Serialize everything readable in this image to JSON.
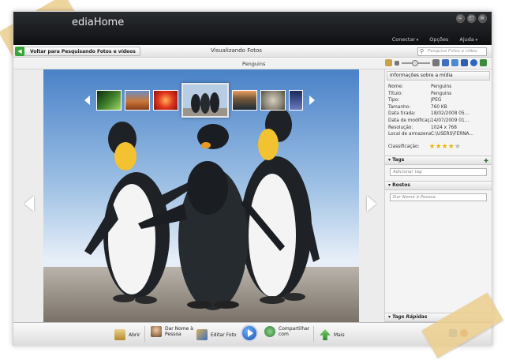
{
  "window": {
    "title": "MediaHome",
    "title_visible": "ediaHome",
    "menu": [
      "Conectar",
      "Opções",
      "Ajuda"
    ]
  },
  "nav": {
    "back_label": "Voltar para Pesquisando Fotos e vídeos",
    "view_title": "Visualizando Fotos",
    "search_placeholder": "Pesquisa Fotos e vídeo"
  },
  "photo": {
    "name": "Penguins",
    "zoom_fraction": 0.45
  },
  "filmstrip": {
    "thumbnails": [
      "flower-green",
      "desert",
      "chrysanthemum",
      "penguins",
      "lighthouse",
      "koala",
      "jellyfish"
    ],
    "selected_index": 3
  },
  "panel": {
    "header": "Informações sobre a mídia",
    "properties": [
      {
        "key": "Nome:",
        "value": "Penguins"
      },
      {
        "key": "Título:",
        "value": "Penguins"
      },
      {
        "key": "Tipo:",
        "value": "JPEG"
      },
      {
        "key": "Tamanho:",
        "value": "760 KB"
      },
      {
        "key": "Data tirada:",
        "value": "18/02/2008 05..."
      },
      {
        "key": "Data de modificação:",
        "value": "14/07/2009 01..."
      },
      {
        "key": "Resolução:",
        "value": "1024 x 768"
      },
      {
        "key": "Local de armazena...",
        "value": "C:\\USERS\\FERNA..."
      }
    ],
    "rating_label": "Classificação:",
    "rating_value": 4,
    "rating_max": 5,
    "tags_header": "Tags",
    "tags_placeholder": "Adicionar tag",
    "faces_header": "Rostos",
    "faces_placeholder": "Dar Nome à Pessoa",
    "quick_tags_header": "Tags Rápidas"
  },
  "toolbar": {
    "open": "Abrir",
    "name_person_1": "Dar Nome à",
    "name_person_2": "Pessoa",
    "edit": "Editar Foto",
    "share_1": "Compartilhar",
    "share_2": "com",
    "more": "Mais"
  },
  "colors": {
    "titlebar": "#1a1c1e",
    "accent_green": "#37a536",
    "star_on": "#e9b814",
    "star_off": "#b9b9b9",
    "play_blue": "#1a4da8"
  }
}
